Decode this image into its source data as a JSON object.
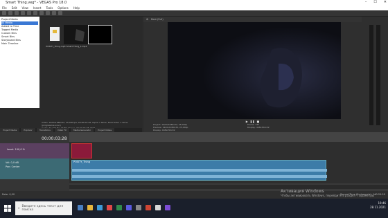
{
  "titlebar": {
    "title": "Smart Thing.veg* - VEGAS Pro 18.0",
    "controls": [
      "–",
      "☐",
      "✕"
    ]
  },
  "menu": [
    "File",
    "Edit",
    "View",
    "Insert",
    "Tools",
    "Options",
    "Help"
  ],
  "explorer": {
    "tree": [
      "Project Media",
      "All Media",
      "Added to Time",
      "Tagged Media",
      "Custom Bins",
      "Smart Bins",
      "Storyboard Bins",
      "Main Timeline"
    ],
    "thumbs": [
      {
        "label": "POSITY_Thing.mp3"
      },
      {
        "label": "Smart Thing_1.mp4"
      },
      {
        "label": ""
      }
    ],
    "info_line1": "Video: 1920x1080x32, 25,000 fps, 00:00:03:26, Alpha = None, Field Order = None (progressive scan)",
    "info_line2": "Audio: 44 100 Hz, 16 Bit, Stereo, 00:00:03:28, PCM"
  },
  "lower_tabs": [
    "Project Media",
    "Explorer",
    "Transitions",
    "Video FX",
    "Media Generator",
    "Project Notes"
  ],
  "preview": {
    "toolbar": "Best (Full)",
    "info": {
      "project": "Project: 1920x1080x32, 25,000p",
      "preview": "Preview: 1920x1080x32, 25,000p",
      "display": "Display: 448x252x32",
      "frame_label": "Frame:",
      "frame": "135",
      "display_label": "Display:",
      "display_value": "448x252x32"
    },
    "tabs": [
      "Video Preview",
      "Trimmer"
    ]
  },
  "timeline": {
    "timecode": "00:00:03:28",
    "track1": {
      "level": "Level: 100,0 %"
    },
    "track2": {
      "vol": "Vol:",
      "vol_value": "0,0 dB",
      "pan": "Pan:",
      "pan_value": "Center"
    },
    "clip_name": "POSITY_Thing"
  },
  "status": {
    "rate": "Rate: 0,00",
    "record_time": "Record Time (2 channels): 140:29:20"
  },
  "taskbar": {
    "search_placeholder": "Введите здесь текст для поиска",
    "time": "19:46",
    "date": "28.11.2021"
  },
  "watermark": {
    "line1": "Активация Windows",
    "line2": "Чтобы активировать Windows, перейдите в раздел \"Параметры\""
  },
  "colors": {
    "video_clip": "#8b1a3a",
    "audio_clip": "#3d7ca8",
    "audio_track_header": "#3c6a74",
    "video_track_header": "#5b4060"
  }
}
